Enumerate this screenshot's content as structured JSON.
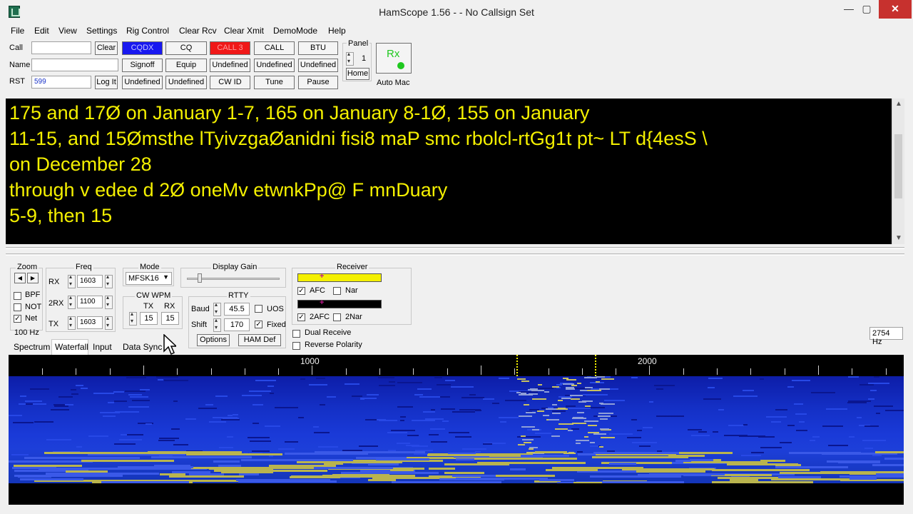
{
  "window": {
    "title": "HamScope 1.56 - - No Callsign Set",
    "minimize": "—",
    "maximize": "▢",
    "close": "✕"
  },
  "menu": [
    "File",
    "Edit",
    "View",
    "Settings",
    "Rig Control",
    "Clear Rcv",
    "Clear Xmit",
    "DemoMode",
    "Help"
  ],
  "entry": {
    "call_label": "Call",
    "name_label": "Name",
    "rst_label": "RST",
    "call_value": "",
    "name_value": "",
    "rst_value": "599",
    "clear_button": "Clear",
    "logit_button": "Log It"
  },
  "macros": {
    "row1": [
      "CQDX",
      "CQ",
      "CALL 3",
      "CALL",
      "BTU"
    ],
    "row2": [
      "Signoff",
      "Equip",
      "Undefined",
      "Undefined",
      "Undefined"
    ],
    "row3": [
      "Undefined",
      "Undefined",
      "CW ID",
      "Tune",
      "Pause"
    ]
  },
  "panel": {
    "label": "Panel",
    "value": "1",
    "home": "Home"
  },
  "rx_button": {
    "label": "Rx",
    "indicator_color": "#1fc81f"
  },
  "auto_mac": "Auto Mac",
  "receive_text": [
    "175 and 17Ø on January 1-7, 165 on January 8-1Ø, 155 on January",
    "11-15, and 15Ømsthe lTyivzgaØanidni fisi8 maP smc rbolcl-rtGg1t pt~    LT d{4esS  \\",
    "on December 28",
    "through v edee d 2Ø oneMv etwnkPp@ F mnDuary",
    "5-9, then 15"
  ],
  "zoom": {
    "label": "Zoom",
    "left": "◀",
    "right": "▶"
  },
  "filters": [
    {
      "label": "BPF",
      "checked": false
    },
    {
      "label": "NOT",
      "checked": false
    },
    {
      "label": "Net",
      "checked": true
    }
  ],
  "bandwidth": "100 Hz",
  "freq": {
    "label": "Freq",
    "rx_label": "RX",
    "rx_value": "1603",
    "rx2_label": "2RX",
    "rx2_value": "1100",
    "tx_label": "TX",
    "tx_value": "1603"
  },
  "mode": {
    "label": "Mode",
    "value": "MFSK16"
  },
  "cw_wpm": {
    "label": "CW WPM",
    "tx_label": "TX",
    "rx_label": "RX",
    "tx_value": "15",
    "rx_value": "15"
  },
  "display_gain": {
    "label": "Display Gain",
    "level": 0.12
  },
  "rtty": {
    "label": "RTTY",
    "baud_label": "Baud",
    "baud_value": "45.5",
    "shift_label": "Shift",
    "shift_value": "170",
    "uos_label": "UOS",
    "uos_checked": false,
    "fixed_label": "Fixed",
    "fixed_checked": true,
    "options_button": "Options",
    "hamdef_button": "HAM Def"
  },
  "receiver": {
    "label": "Receiver",
    "afc_label": "AFC",
    "afc_checked": true,
    "nar_label": "Nar",
    "nar_checked": false,
    "afc2_label": "2AFC",
    "afc2_checked": true,
    "nar2_label": "2Nar",
    "nar2_checked": false,
    "tuning_color": "#f4f000"
  },
  "dual_receive": {
    "label": "Dual Receive",
    "checked": false
  },
  "reverse_polarity": {
    "label": "Reverse Polarity",
    "checked": false
  },
  "cursor_freq": "2754 Hz",
  "tabs": [
    "Spectrum",
    "Waterfall",
    "Input",
    "Data Sync"
  ],
  "scale": {
    "labels": [
      "1000",
      "2000"
    ]
  }
}
